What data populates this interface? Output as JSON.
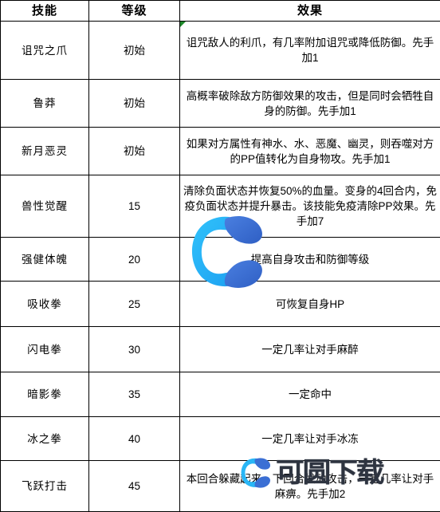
{
  "table": {
    "headers": [
      "技能",
      "等级",
      "效果"
    ],
    "rows": [
      {
        "skill": "诅咒之爪",
        "level": "初始",
        "effect": "诅咒敌人的利爪，有几率附加诅咒或降低防御。先手加1",
        "flag": true
      },
      {
        "skill": "鲁莽",
        "level": "初始",
        "effect": "高概率破除敌方防御效果的攻击，但是同时会牺牲自身的防御。先手加1",
        "flag": false
      },
      {
        "skill": "新月恶灵",
        "level": "初始",
        "effect": "如果对方属性有神水、水、恶魔、幽灵，则吞噬对方的PP值转化为自身物攻。先手加1",
        "flag": false
      },
      {
        "skill": "兽性觉醒",
        "level": "15",
        "effect": "清除负面状态并恢复50%的血量。变身的4回合内，免疫负面状态并提升暴击。该技能免疫清除PP效果。先手加7",
        "flag": false
      },
      {
        "skill": "强健体魄",
        "level": "20",
        "effect": "提高自身攻击和防御等级",
        "flag": false
      },
      {
        "skill": "吸收拳",
        "level": "25",
        "effect": "可恢复自身HP",
        "flag": false
      },
      {
        "skill": "闪电拳",
        "level": "30",
        "effect": "一定几率让对手麻醉",
        "flag": false
      },
      {
        "skill": "暗影拳",
        "level": "35",
        "effect": "一定命中",
        "flag": false
      },
      {
        "skill": "冰之拳",
        "level": "40",
        "effect": "一定几率让对手冰冻",
        "flag": false
      },
      {
        "skill": "飞跃打击",
        "level": "45",
        "effect": "本回合躲藏起来，下回合发动攻击，一定几率让对手麻痹。先手加2",
        "flag": false
      }
    ]
  },
  "watermark": {
    "text": "可圆下载",
    "logo_name": "c-swirl-logo",
    "colors": {
      "logo_light": "#29b6f6",
      "logo_dark": "#3b6fd4",
      "text": "#2e3440"
    }
  },
  "colors": {
    "border": "#000000",
    "background": "#ffffff",
    "text": "#000000",
    "flag": "#1f8a2b"
  }
}
